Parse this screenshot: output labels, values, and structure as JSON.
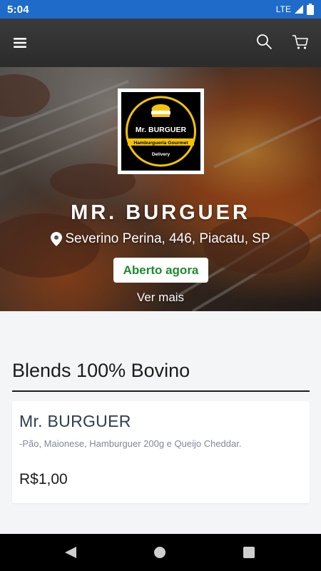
{
  "status_bar": {
    "time": "5:04",
    "network": "LTE"
  },
  "app_bar": {
    "icons": [
      "menu-icon",
      "search-icon",
      "cart-icon"
    ]
  },
  "hero": {
    "logo": {
      "brand": "Mr. BURGUER",
      "ribbon": "Hamburgueria Gourmet",
      "tagline": "Delivery"
    },
    "name": "MR. BURGUER",
    "address": "Severino Perina, 446, Piacatu, SP",
    "status": "Aberto agora",
    "see_more": "Ver mais"
  },
  "menu": {
    "section_title": "Blends 100% Bovino",
    "items": [
      {
        "name": "Mr. BURGUER",
        "description": "-Pão, Maionese, Hamburguer 200g e Queijo Cheddar.",
        "price": "R$1,00"
      }
    ]
  },
  "colors": {
    "status_bar": "#1f6bc9",
    "app_bar": "#333333",
    "open_green": "#1e8a2e",
    "logo_yellow": "#f5c400"
  }
}
